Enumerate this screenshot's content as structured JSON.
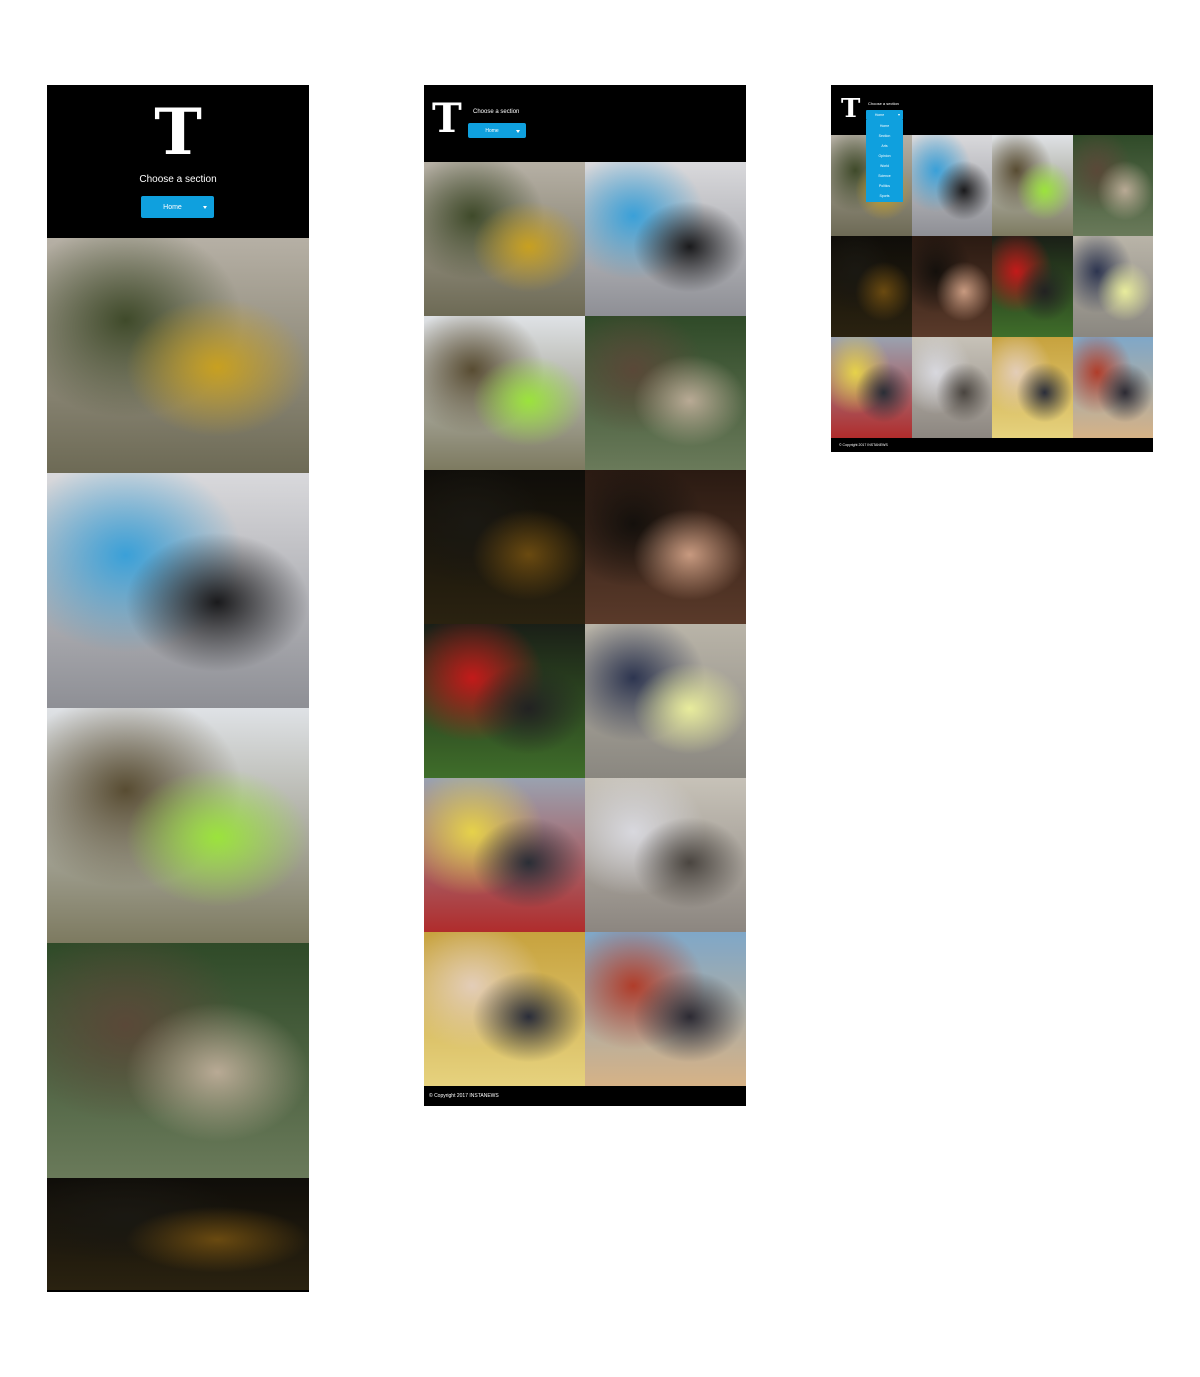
{
  "header": {
    "logo_letter": "T",
    "prompt": "Choose a section",
    "selected_section": "Home"
  },
  "dropdown": {
    "options": [
      "Home",
      "Section",
      "Arts",
      "Opinion",
      "World",
      "Science",
      "Politics",
      "Sports"
    ]
  },
  "footer": {
    "copyright": "© Copyright 2017 INSTANEWS"
  },
  "photos": [
    {
      "name": "hurricane-cleanup-wheelbarrow",
      "colors": [
        "#b6b0a5",
        "#6d6a55",
        "#c8a020",
        "#3f4a2a"
      ]
    },
    {
      "name": "man-carrying-bags-porch",
      "colors": [
        "#d9d9dc",
        "#8e8f95",
        "#1a1a1c",
        "#3aa0d8"
      ]
    },
    {
      "name": "soldiers-passing-water",
      "colors": [
        "#dfe2e6",
        "#7d7a60",
        "#9be33c",
        "#584c32"
      ]
    },
    {
      "name": "street-debris-cleanup",
      "colors": [
        "#2f4a28",
        "#6a7a5a",
        "#b9aa95",
        "#5a4838"
      ]
    },
    {
      "name": "night-flood-scene",
      "colors": [
        "#0f0d09",
        "#2a2210",
        "#6a4a10",
        "#1a1812"
      ]
    },
    {
      "name": "comey-testimony",
      "colors": [
        "#2a1a12",
        "#5a3a2a",
        "#c89a80",
        "#14100c"
      ]
    },
    {
      "name": "trump-marine-lawn",
      "colors": [
        "#1a1f17",
        "#3f6e2a",
        "#222",
        "#c31a1a"
      ]
    },
    {
      "name": "voters-reading-ballot",
      "colors": [
        "#b9b4a8",
        "#8a8780",
        "#e8ec9c",
        "#2d3550"
      ]
    },
    {
      "name": "engine-factory",
      "colors": [
        "#9aa2b0",
        "#b02c2c",
        "#2a2e36",
        "#e6d24a"
      ]
    },
    {
      "name": "construction-scaffolding",
      "colors": [
        "#c7c2b8",
        "#8c8680",
        "#4a4540",
        "#d8d8de"
      ]
    },
    {
      "name": "oval-office",
      "colors": [
        "#c7a23e",
        "#e6d27e",
        "#2a2d3a",
        "#e3cdb8"
      ]
    },
    {
      "name": "daca-protest",
      "colors": [
        "#7fa7c8",
        "#d6b286",
        "#2c2a33",
        "#b03d2a"
      ]
    }
  ]
}
